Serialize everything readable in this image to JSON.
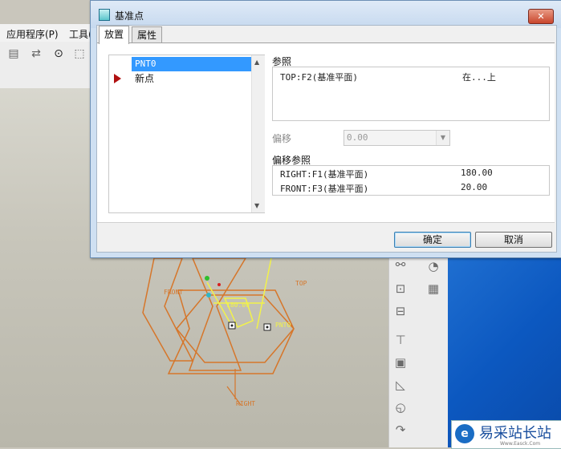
{
  "dialog": {
    "title": "基准点",
    "close_label": "✕",
    "tabs": [
      {
        "label": "放置",
        "active": true
      },
      {
        "label": "属性",
        "active": false
      }
    ],
    "points_list": [
      {
        "label": "PNT0",
        "selected": true
      },
      {
        "label": "新点",
        "selected": false
      }
    ],
    "reference": {
      "heading": "参照",
      "rows": [
        {
          "name": "TOP:F2(基准平面)",
          "constraint": "在...上"
        }
      ]
    },
    "offset": {
      "label": "偏移",
      "value": "0.00"
    },
    "offset_reference": {
      "heading": "偏移参照",
      "rows": [
        {
          "name": "RIGHT:F1(基准平面)",
          "value": "180.00"
        },
        {
          "name": "FRONT:F3(基准平面)",
          "value": "20.00"
        }
      ]
    },
    "buttons": {
      "ok": "确定",
      "cancel": "取消"
    }
  },
  "background_app": {
    "menu": [
      "应用程序(P)",
      "工具("
    ],
    "viewport_labels": {
      "front": "FRONT",
      "top": "TOP",
      "right": "RIGHT",
      "pnt": "PNT0",
      "dimension": "180.00"
    }
  },
  "watermark": {
    "text": "易采站长站",
    "subtext": "Www.Easck.Com"
  },
  "colors": {
    "datum_plane": "#d6762a",
    "selection": "#3399ff",
    "preview": "#f2f24a"
  }
}
